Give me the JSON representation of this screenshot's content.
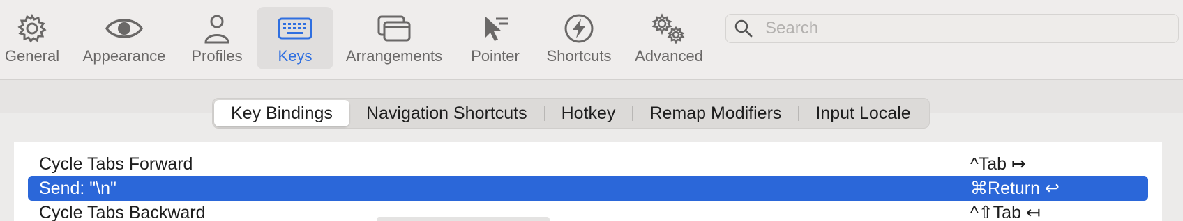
{
  "toolbar": {
    "items": [
      {
        "label": "General",
        "icon": "gear-icon"
      },
      {
        "label": "Appearance",
        "icon": "eye-icon"
      },
      {
        "label": "Profiles",
        "icon": "person-icon"
      },
      {
        "label": "Keys",
        "icon": "keyboard-icon",
        "selected": true
      },
      {
        "label": "Arrangements",
        "icon": "windows-icon"
      },
      {
        "label": "Pointer",
        "icon": "pointer-icon"
      },
      {
        "label": "Shortcuts",
        "icon": "bolt-icon"
      },
      {
        "label": "Advanced",
        "icon": "gears-icon"
      }
    ],
    "search_placeholder": "Search",
    "accent": "#2f6fe0"
  },
  "tabs": {
    "items": [
      "Key Bindings",
      "Navigation Shortcuts",
      "Hotkey",
      "Remap Modifiers",
      "Input Locale"
    ],
    "active": "Key Bindings"
  },
  "bindings": {
    "rows": [
      {
        "action": "Cycle Tabs Forward",
        "shortcut": "^Tab ↦"
      },
      {
        "action": "Send: \"\\n\"",
        "shortcut": "⌘Return ↩",
        "selected": true
      },
      {
        "action": "Cycle Tabs Backward",
        "shortcut": "^⇧Tab ↤"
      }
    ],
    "selection_color": "#2b67d9"
  }
}
